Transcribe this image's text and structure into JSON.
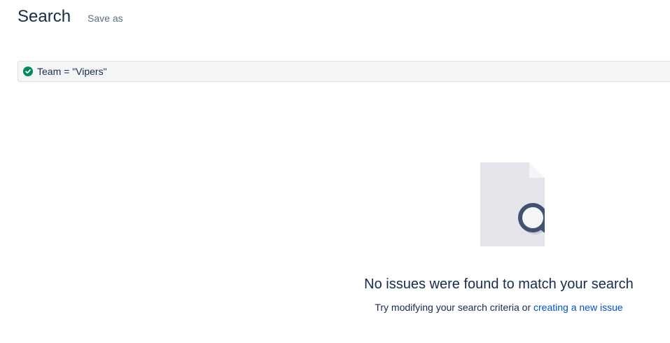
{
  "header": {
    "title": "Search",
    "save_as_label": "Save as"
  },
  "jql": {
    "query": "Team = \"Vipers\"",
    "status_icon": "check-circle-icon",
    "status_color": "#00875a"
  },
  "empty_state": {
    "illustration_icon": "document-search-icon",
    "title": "No issues were found to match your search",
    "description_prefix": "Try modifying your search criteria or ",
    "link_label": "creating a new issue"
  },
  "colors": {
    "text": "#172b4d",
    "link": "#0052cc",
    "bar_bg": "#f4f5f7"
  }
}
